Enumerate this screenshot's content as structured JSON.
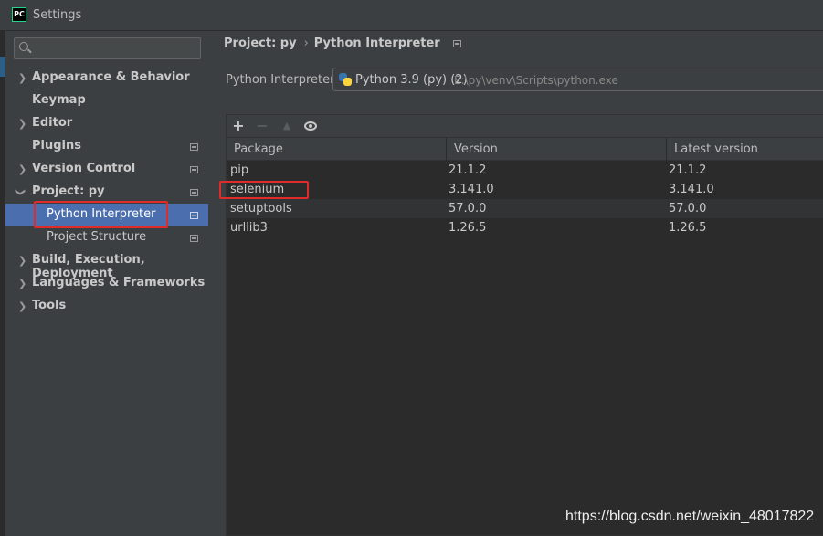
{
  "window": {
    "title": "Settings",
    "icon_text": "PC"
  },
  "sidebar": {
    "search_placeholder": "",
    "items": [
      {
        "label": "Appearance & Behavior",
        "expandable": true,
        "expanded": false
      },
      {
        "label": "Keymap",
        "expandable": false
      },
      {
        "label": "Editor",
        "expandable": true,
        "expanded": false
      },
      {
        "label": "Plugins",
        "expandable": false,
        "project_icon": true
      },
      {
        "label": "Version Control",
        "expandable": true,
        "expanded": false,
        "project_icon": true
      },
      {
        "label": "Project: py",
        "expandable": true,
        "expanded": true,
        "project_icon": true
      },
      {
        "label": "Python Interpreter",
        "sub": true,
        "selected": true,
        "project_icon": true
      },
      {
        "label": "Project Structure",
        "sub": true,
        "project_icon": true
      },
      {
        "label": "Build, Execution, Deployment",
        "expandable": true,
        "expanded": false
      },
      {
        "label": "Languages & Frameworks",
        "expandable": true,
        "expanded": false
      },
      {
        "label": "Tools",
        "expandable": true,
        "expanded": false
      }
    ]
  },
  "breadcrumb": {
    "parent": "Project: py",
    "current": "Python Interpreter"
  },
  "interpreter": {
    "label": "Python Interpreter:",
    "name": "Python 3.9 (py) (2)",
    "path": "E:\\py\\venv\\Scripts\\python.exe"
  },
  "packages": {
    "toolbar": {
      "add": "+",
      "remove": "−",
      "upgrade": "▲"
    },
    "columns": [
      "Package",
      "Version",
      "Latest version"
    ],
    "rows": [
      [
        "pip",
        "21.1.2",
        "21.1.2"
      ],
      [
        "selenium",
        "3.141.0",
        "3.141.0"
      ],
      [
        "setuptools",
        "57.0.0",
        "57.0.0"
      ],
      [
        "urllib3",
        "1.26.5",
        "1.26.5"
      ]
    ]
  },
  "watermark": "https://blog.csdn.net/weixin_48017822",
  "colors": {
    "selection": "#4b6eaf",
    "highlight_box": "#e02b2b",
    "background": "#3c3f41"
  }
}
